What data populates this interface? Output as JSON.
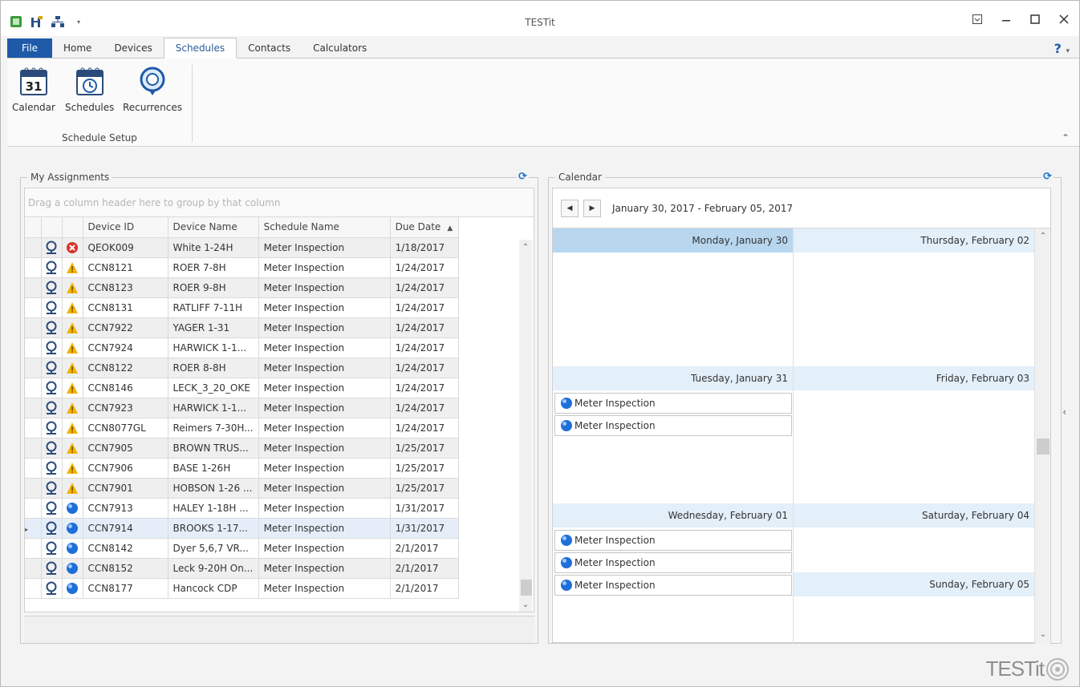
{
  "window": {
    "title": "TESTit"
  },
  "ribbon": {
    "tabs": [
      {
        "label": "File"
      },
      {
        "label": "Home"
      },
      {
        "label": "Devices"
      },
      {
        "label": "Schedules"
      },
      {
        "label": "Contacts"
      },
      {
        "label": "Calculators"
      }
    ],
    "active_tab": "Schedules",
    "help_label": "?",
    "buttons": [
      {
        "label": "Calendar",
        "icon": "calendar-icon"
      },
      {
        "label": "Schedules",
        "icon": "schedules-icon"
      },
      {
        "label": "Recurrences",
        "icon": "recurrences-icon"
      }
    ],
    "group_label": "Schedule Setup"
  },
  "assignments": {
    "title": "My Assignments",
    "group_hint": "Drag a column header here to group by that column",
    "columns": [
      "Device ID",
      "Device Name",
      "Schedule Name",
      "Due Date"
    ],
    "sort_column": "Due Date",
    "sort_direction": "ascending",
    "rows": [
      {
        "device_id": "QEOK009",
        "device_name": "White 1-24H",
        "schedule": "Meter Inspection",
        "due": "1/18/2017",
        "status": "error"
      },
      {
        "device_id": "CCN8121",
        "device_name": "ROER 7-8H",
        "schedule": "Meter Inspection",
        "due": "1/24/2017",
        "status": "warning"
      },
      {
        "device_id": "CCN8123",
        "device_name": "ROER 9-8H",
        "schedule": "Meter Inspection",
        "due": "1/24/2017",
        "status": "warning"
      },
      {
        "device_id": "CCN8131",
        "device_name": "RATLIFF 7-11H",
        "schedule": "Meter Inspection",
        "due": "1/24/2017",
        "status": "warning"
      },
      {
        "device_id": "CCN7922",
        "device_name": "YAGER 1-31",
        "schedule": "Meter Inspection",
        "due": "1/24/2017",
        "status": "warning"
      },
      {
        "device_id": "CCN7924",
        "device_name": "HARWICK 1-1...",
        "schedule": "Meter Inspection",
        "due": "1/24/2017",
        "status": "warning"
      },
      {
        "device_id": "CCN8122",
        "device_name": "ROER 8-8H",
        "schedule": "Meter Inspection",
        "due": "1/24/2017",
        "status": "warning"
      },
      {
        "device_id": "CCN8146",
        "device_name": "LECK_3_20_OKE",
        "schedule": "Meter Inspection",
        "due": "1/24/2017",
        "status": "warning"
      },
      {
        "device_id": "CCN7923",
        "device_name": "HARWICK 1-1...",
        "schedule": "Meter Inspection",
        "due": "1/24/2017",
        "status": "warning"
      },
      {
        "device_id": "CCN8077GL",
        "device_name": "Reimers 7-30H...",
        "schedule": "Meter Inspection",
        "due": "1/24/2017",
        "status": "warning"
      },
      {
        "device_id": "CCN7905",
        "device_name": "BROWN TRUS...",
        "schedule": "Meter Inspection",
        "due": "1/25/2017",
        "status": "warning"
      },
      {
        "device_id": "CCN7906",
        "device_name": "BASE 1-26H",
        "schedule": "Meter Inspection",
        "due": "1/25/2017",
        "status": "warning"
      },
      {
        "device_id": "CCN7901",
        "device_name": "HOBSON 1-26 ...",
        "schedule": "Meter Inspection",
        "due": "1/25/2017",
        "status": "warning"
      },
      {
        "device_id": "CCN7913",
        "device_name": "HALEY 1-18H ...",
        "schedule": "Meter Inspection",
        "due": "1/31/2017",
        "status": "ok"
      },
      {
        "device_id": "CCN7914",
        "device_name": "BROOKS 1-17...",
        "schedule": "Meter Inspection",
        "due": "1/31/2017",
        "status": "ok",
        "selected": true
      },
      {
        "device_id": "CCN8142",
        "device_name": "Dyer 5,6,7 VR...",
        "schedule": "Meter Inspection",
        "due": "2/1/2017",
        "status": "ok"
      },
      {
        "device_id": "CCN8152",
        "device_name": "Leck 9-20H On...",
        "schedule": "Meter Inspection",
        "due": "2/1/2017",
        "status": "ok"
      },
      {
        "device_id": "CCN8177",
        "device_name": "Hancock CDP",
        "schedule": "Meter Inspection",
        "due": "2/1/2017",
        "status": "ok"
      }
    ]
  },
  "calendar": {
    "title": "Calendar",
    "range": "January 30, 2017 - February 05, 2017",
    "days_left": [
      {
        "label": "Monday, January 30",
        "today": true,
        "appointments": []
      },
      {
        "label": "Tuesday, January 31",
        "appointments": [
          "Meter Inspection",
          "Meter Inspection"
        ]
      },
      {
        "label": "Wednesday, February 01",
        "appointments": [
          "Meter Inspection",
          "Meter Inspection",
          "Meter Inspection"
        ]
      }
    ],
    "days_right": [
      {
        "label": "Thursday, February 02"
      },
      {
        "label": "Friday, February 03"
      },
      {
        "label": "Saturday, February 04"
      },
      {
        "label": "Sunday, February 05"
      }
    ]
  },
  "brand": {
    "text": "TESTit"
  },
  "colors": {
    "accent": "#1e5aa8",
    "today_header": "#b9d6ef",
    "day_header": "#e3eff9",
    "warning": "#f2b400",
    "error": "#d9342b",
    "ok": "#1e6fd9"
  }
}
